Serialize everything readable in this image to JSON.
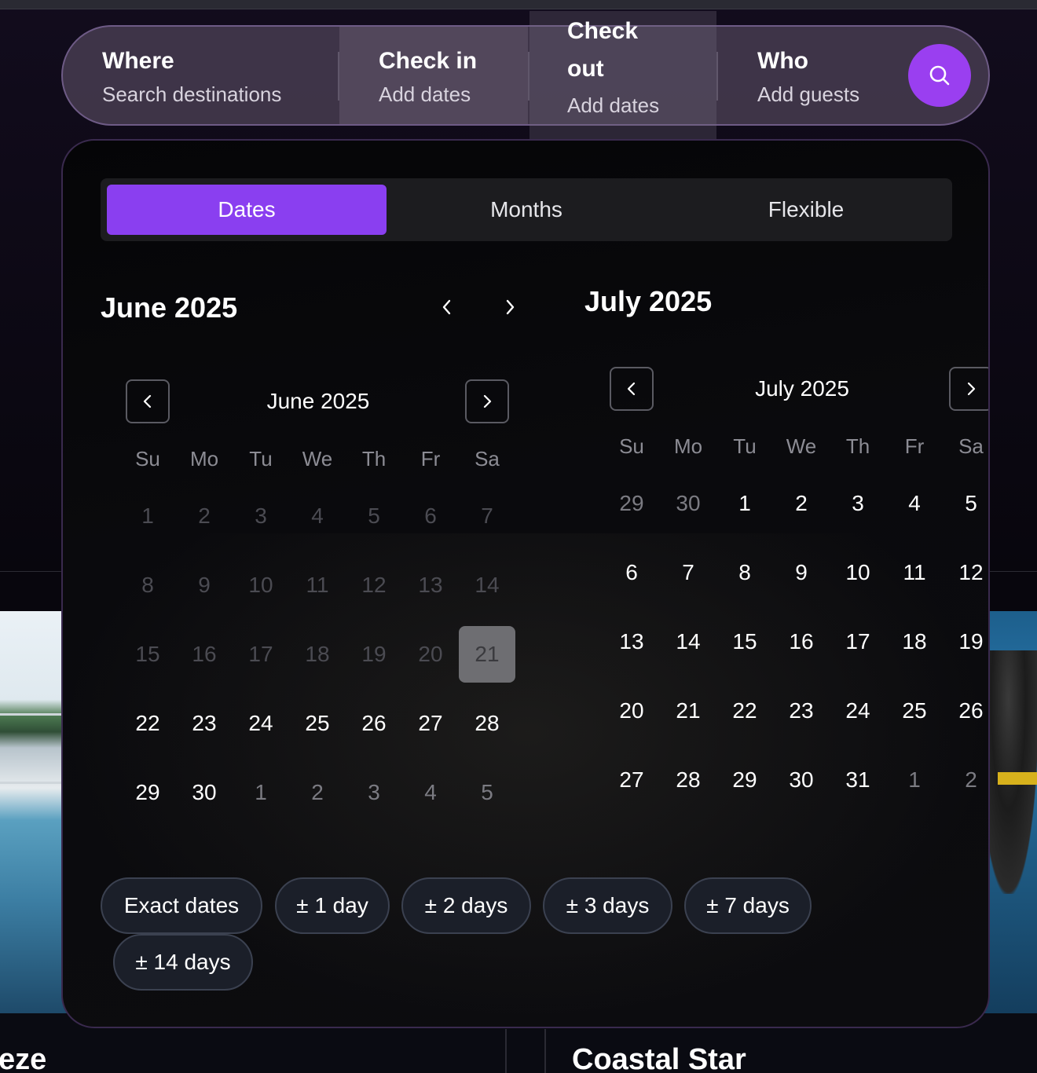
{
  "search": {
    "where": {
      "label": "Where",
      "value": "Search destinations"
    },
    "checkin": {
      "label": "Check in",
      "value": "Add dates"
    },
    "checkout": {
      "label": "Check out",
      "value": "Add dates"
    },
    "who": {
      "label": "Who",
      "value": "Add guests"
    },
    "button_icon": "search-icon",
    "accent": "#9a3ff0"
  },
  "tabs": [
    "Dates",
    "Months",
    "Flexible"
  ],
  "active_tab": "Dates",
  "header_months": [
    "June 2025",
    "July 2025"
  ],
  "weekdays": [
    "Su",
    "Mo",
    "Tu",
    "We",
    "Th",
    "Fr",
    "Sa"
  ],
  "calendars": [
    {
      "title": "June 2025",
      "days": [
        [
          "1",
          "2",
          "3",
          "4",
          "5",
          "6",
          "7"
        ],
        [
          "8",
          "9",
          "10",
          "11",
          "12",
          "13",
          "14"
        ],
        [
          "15",
          "16",
          "17",
          "18",
          "19",
          "20",
          "21"
        ],
        [
          "22",
          "23",
          "24",
          "25",
          "26",
          "27",
          "28"
        ],
        [
          "29",
          "30",
          "1",
          "2",
          "3",
          "4",
          "5"
        ]
      ],
      "selected": "21"
    },
    {
      "title": "July 2025",
      "days": [
        [
          "29",
          "30",
          "1",
          "2",
          "3",
          "4",
          "5"
        ],
        [
          "6",
          "7",
          "8",
          "9",
          "10",
          "11",
          "12"
        ],
        [
          "13",
          "14",
          "15",
          "16",
          "17",
          "18",
          "19"
        ],
        [
          "20",
          "21",
          "22",
          "23",
          "24",
          "25",
          "26"
        ],
        [
          "27",
          "28",
          "29",
          "30",
          "31",
          "1",
          "2"
        ]
      ]
    }
  ],
  "flex_options": [
    "Exact dates",
    "± 1 day",
    "± 2 days",
    "± 3 days",
    "± 7 days",
    "± 14 days"
  ],
  "background_cards": [
    "eze",
    "Coastal Star"
  ]
}
